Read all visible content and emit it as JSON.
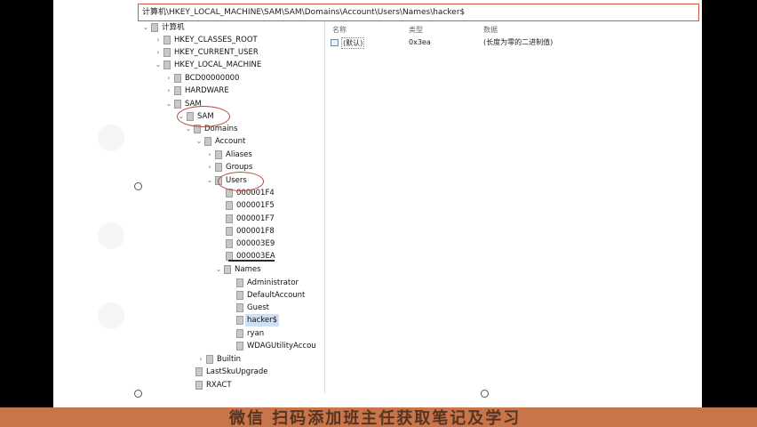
{
  "address_bar": {
    "path": "计算机\\HKEY_LOCAL_MACHINE\\SAM\\SAM\\Domains\\Account\\Users\\Names\\hacker$"
  },
  "tree": {
    "root": "计算机",
    "hkcr": "HKEY_CLASSES_ROOT",
    "hkcu": "HKEY_CURRENT_USER",
    "hklm": "HKEY_LOCAL_MACHINE",
    "bcd": "BCD00000000",
    "hardware": "HARDWARE",
    "sam": "SAM",
    "sam_sub": "SAM",
    "domains": "Domains",
    "account": "Account",
    "aliases": "Aliases",
    "groups": "Groups",
    "users": "Users",
    "u1": "000001F4",
    "u2": "000001F5",
    "u3": "000001F7",
    "u4": "000001F8",
    "u5": "000003E9",
    "u6": "000003EA",
    "names": "Names",
    "n1": "Administrator",
    "n2": "DefaultAccount",
    "n3": "Guest",
    "n4": "hacker$",
    "n5": "ryan",
    "n6": "WDAGUtilityAccou",
    "builtin": "Builtin",
    "lastsku": "LastSkuUpgrade",
    "rxact": "RXACT"
  },
  "list": {
    "headers": {
      "name": "名称",
      "type": "类型",
      "data": "数据"
    },
    "row": {
      "name": "(默认)",
      "type": "0x3ea",
      "data": "(长度为零的二进制值)"
    }
  },
  "banner": {
    "text": "微信 扫码添加班主任获取笔记及学习"
  },
  "colors": {
    "annotation": "#b44a3a",
    "address_border": "#d35745",
    "banner_bg": "#c9754a"
  }
}
